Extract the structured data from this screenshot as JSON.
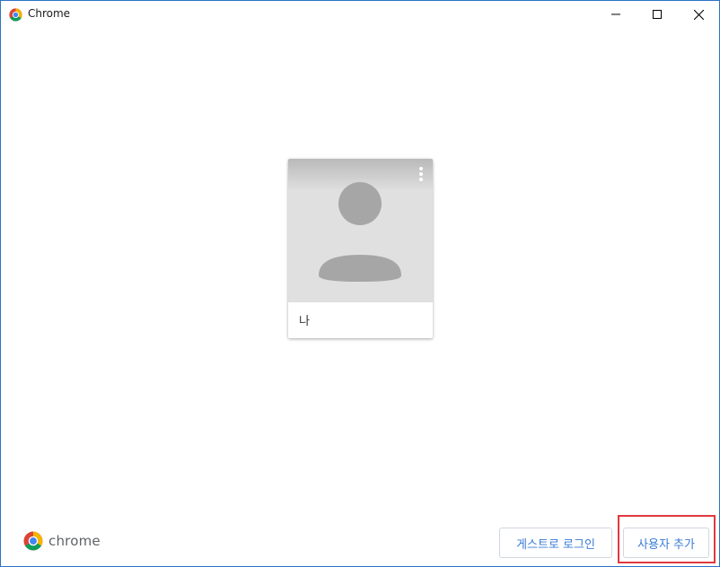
{
  "window": {
    "title": "Chrome",
    "controls": [
      "minimize",
      "maximize",
      "close"
    ]
  },
  "profile": {
    "name": "나",
    "avatar_icon": "person-avatar-icon",
    "menu_icon": "more-vert-icon"
  },
  "footer": {
    "brand_text": "chrome",
    "guest_button": "게스트로 로그인",
    "add_user_button": "사용자 추가"
  },
  "colors": {
    "accent": "#3a7bd5",
    "window_border": "#2b73c4",
    "highlight": "#e0393e",
    "avatar_bg": "#e0e0e0",
    "avatar_fg": "#a6a6a6"
  }
}
